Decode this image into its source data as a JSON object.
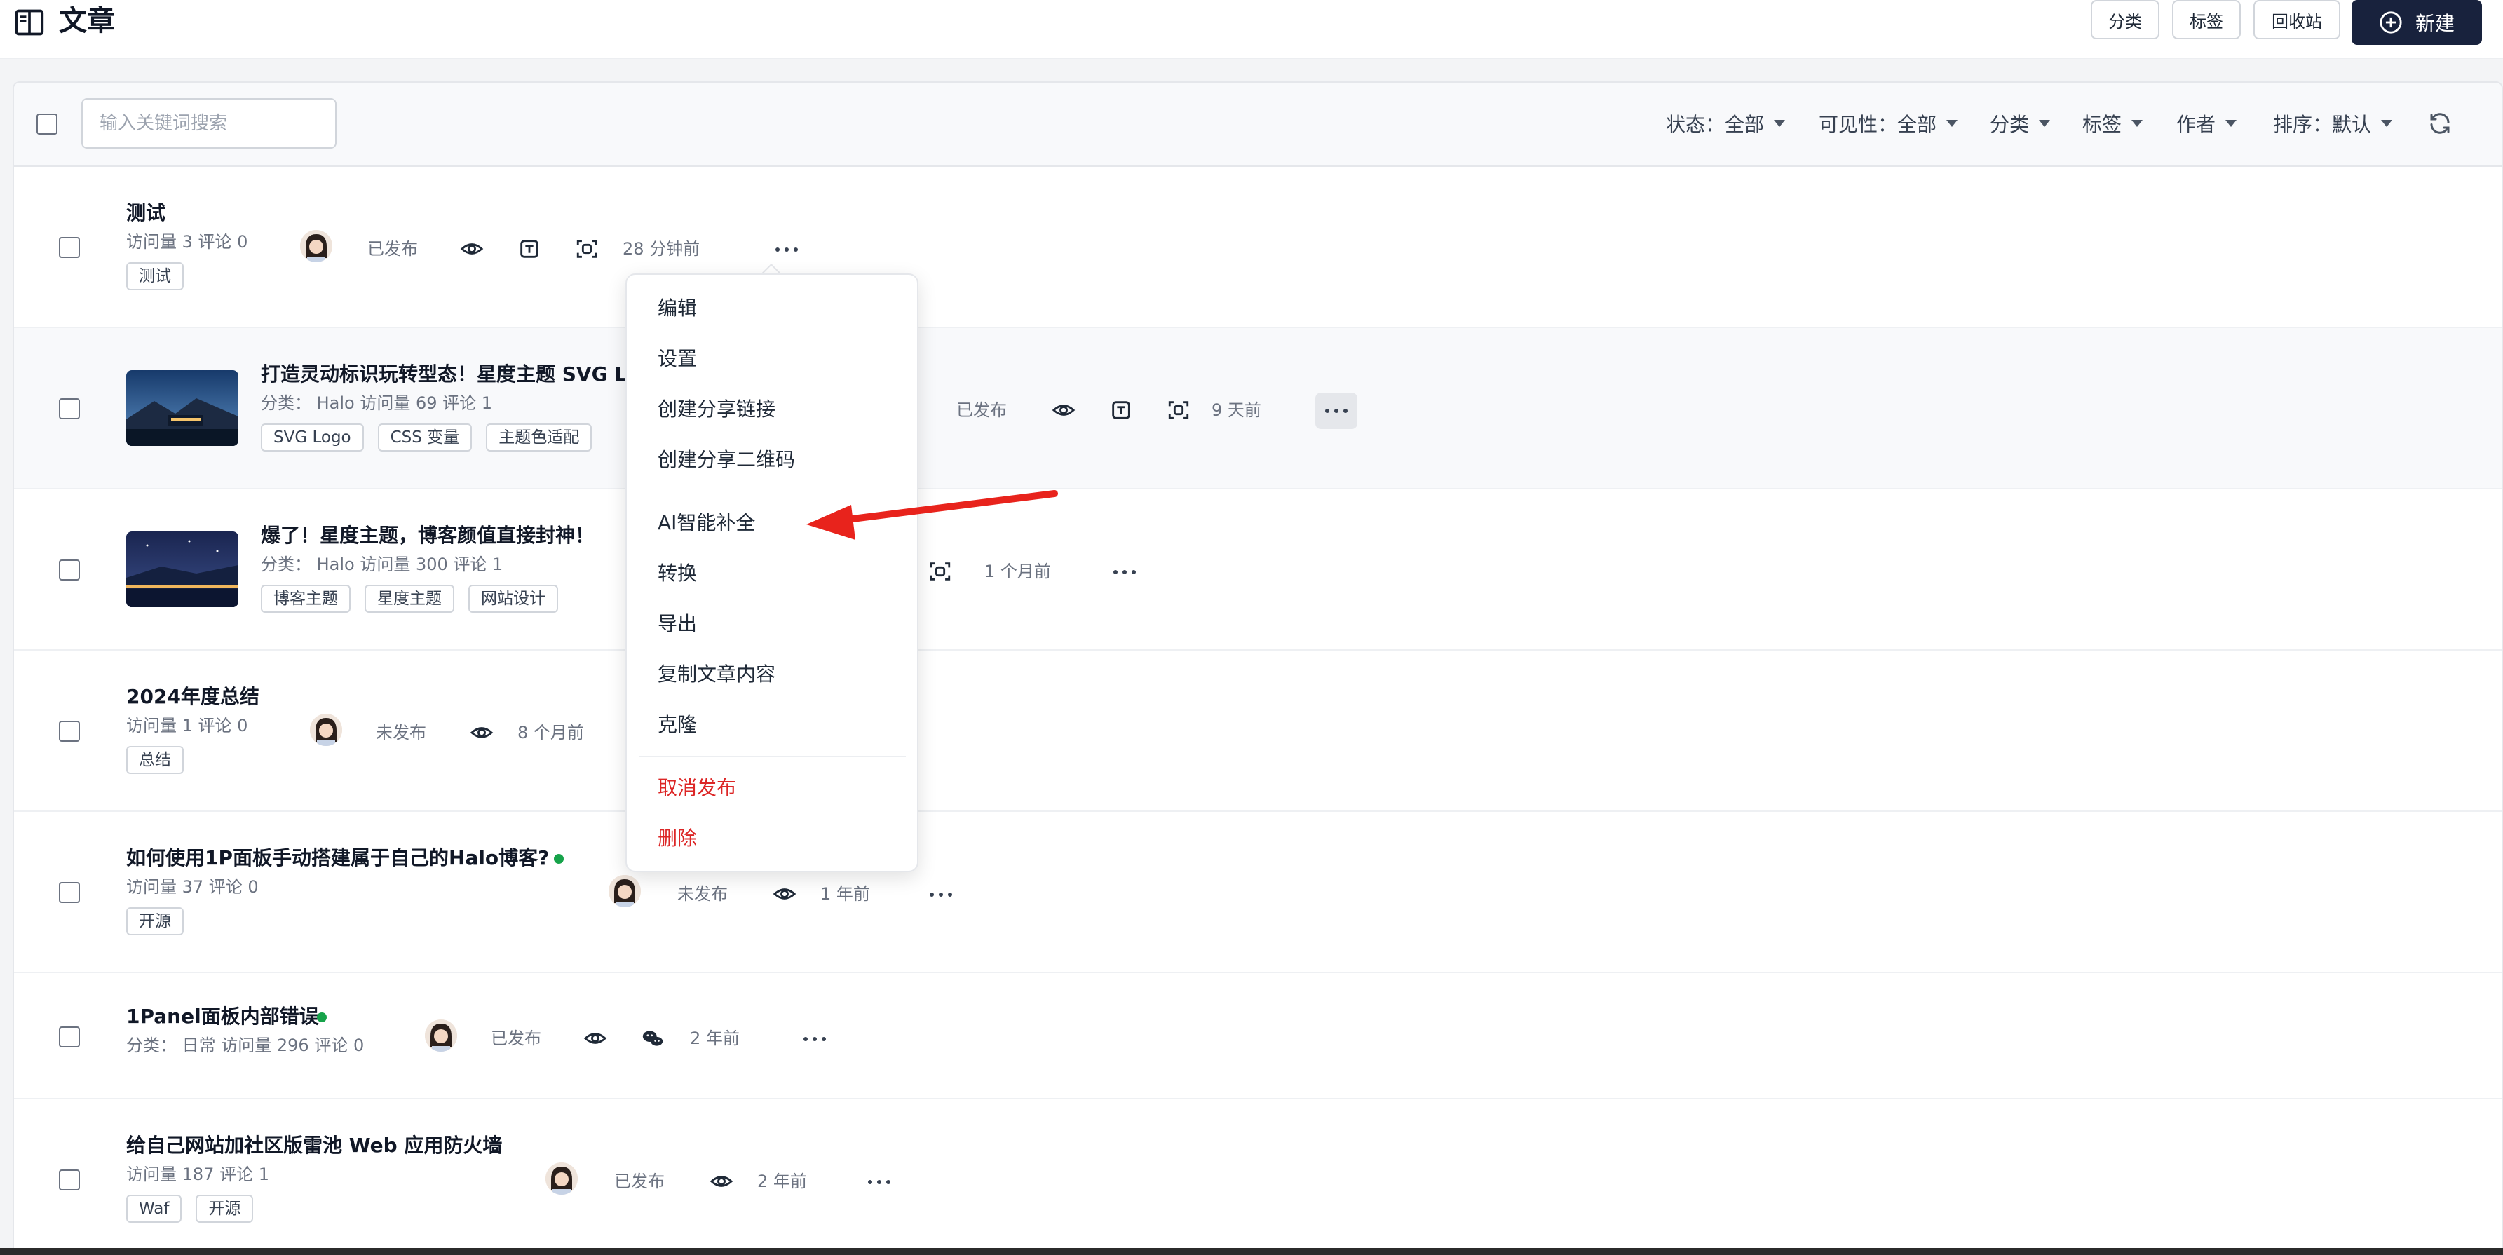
{
  "header": {
    "title": "文章",
    "buttons": {
      "category": "分类",
      "tags": "标签",
      "recycle": "回收站",
      "new": "新建"
    }
  },
  "toolbar": {
    "search_placeholder": "输入关键词搜索",
    "filters": {
      "status": "状态：全部",
      "visibility": "可见性：全部",
      "category": "分类",
      "tag": "标签",
      "author": "作者",
      "sort": "排序：默认"
    }
  },
  "posts": [
    {
      "title": "测试",
      "meta": "访问量 3   评论 0",
      "tags": [
        "测试"
      ],
      "status": "已发布",
      "time": "28 分钟前"
    },
    {
      "title": "打造灵动标识玩转型态！星度主题 SVG Lo",
      "meta": "分类：  Halo   访问量 69   评论 1",
      "tags": [
        "SVG Logo",
        "CSS 变量",
        "主题色适配"
      ],
      "status": "已发布",
      "time": "9 天前"
    },
    {
      "title": "爆了！星度主题，博客颜值直接封神！",
      "meta": "分类：  Halo   访问量 300   评论 1",
      "tags": [
        "博客主题",
        "星度主题",
        "网站设计"
      ],
      "status": "",
      "time": "1 个月前"
    },
    {
      "title": "2024年度总结",
      "meta": "访问量 1   评论 0",
      "tags": [
        "总结"
      ],
      "status": "未发布",
      "time": "8 个月前"
    },
    {
      "title": "如何使用1P面板手动搭建属于自己的Halo博客?",
      "meta": "访问量 37   评论 0",
      "tags": [
        "开源"
      ],
      "status": "未发布",
      "time": "1 年前"
    },
    {
      "title": "1Panel面板内部错误",
      "meta": "分类：  日常   访问量 296   评论 0",
      "tags": [],
      "status": "已发布",
      "time": "2 年前"
    },
    {
      "title": "给自己网站加社区版雷池 Web 应用防火墙",
      "meta": "访问量 187   评论 1",
      "tags": [
        "Waf",
        "开源"
      ],
      "status": "已发布",
      "time": "2 年前"
    }
  ],
  "menu": {
    "items": [
      "编辑",
      "设置",
      "创建分享链接",
      "创建分享二维码",
      "AI智能补全",
      "转换",
      "导出",
      "复制文章内容",
      "克隆"
    ],
    "danger_items": [
      "取消发布",
      "删除"
    ]
  },
  "colors": {
    "primary_button": "#18223d",
    "danger": "#dc2626",
    "published_dot": "#16a34a",
    "annotation_arrow": "#e8231c"
  }
}
